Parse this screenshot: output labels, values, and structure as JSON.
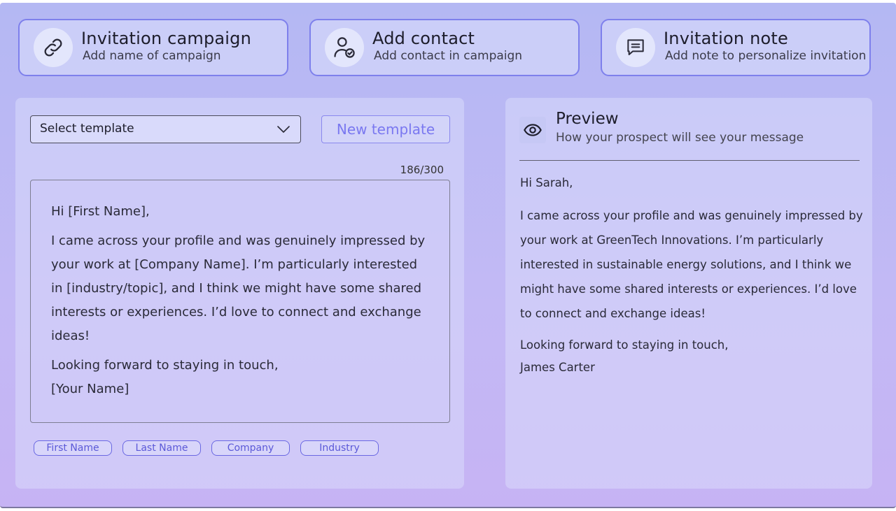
{
  "steps": [
    {
      "title": "Invitation campaign",
      "subtitle": "Add name of campaign",
      "icon": "link-icon"
    },
    {
      "title": "Add contact",
      "subtitle": "Add contact in campaign",
      "icon": "user-check-icon"
    },
    {
      "title": "Invitation note",
      "subtitle": "Add note to personalize invitation",
      "icon": "message-icon"
    }
  ],
  "editor": {
    "select_label": "Select template",
    "new_template_label": "New template",
    "counter": "186/300",
    "message": {
      "greeting": "Hi [First Name],",
      "body": "I came across your profile and was genuinely impressed by your work at [Company Name]. I’m particularly interested in [industry/topic], and I think we might have some shared interests or experiences. I’d love to connect and exchange ideas!",
      "closing": "Looking forward to staying in touch,",
      "signature": "[Your Name]"
    },
    "tags": [
      "First Name",
      "Last Name",
      "Company",
      "Industry"
    ]
  },
  "preview": {
    "title": "Preview",
    "subtitle": "How your prospect will see your message",
    "icon": "eye-icon",
    "greeting": "Hi Sarah,",
    "body": "I came across your profile and was genuinely impressed by your work at GreenTech Innovations. I’m particularly interested in sustainable energy solutions, and I think we might have some shared interests or experiences. I’d love to connect and exchange ideas!",
    "closing": "Looking forward to staying in touch,",
    "signature": "James Carter"
  },
  "colors": {
    "accent": "#7a78f0",
    "background": "#b4b8f3",
    "step_border": "#7e80ec"
  }
}
